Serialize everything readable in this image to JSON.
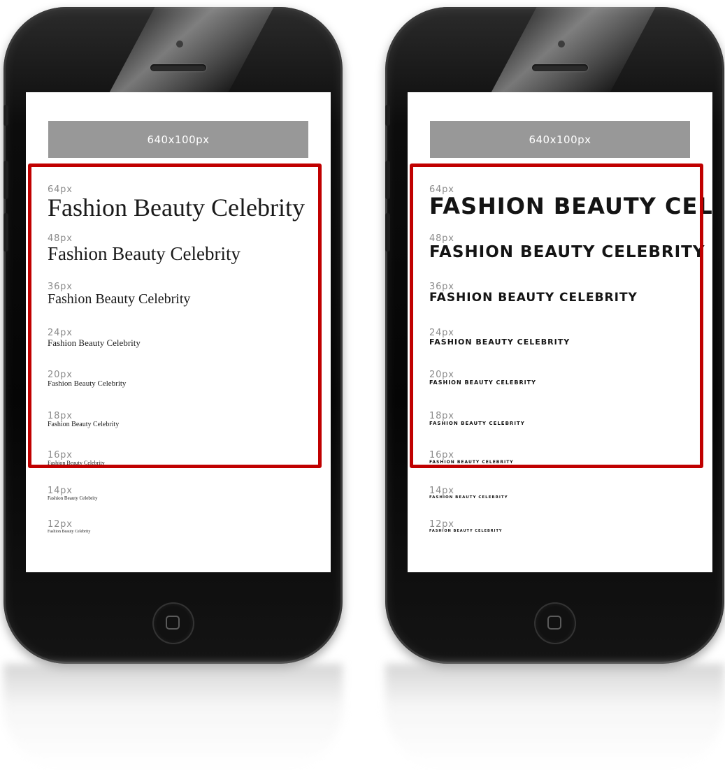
{
  "banner_label": "640x100px",
  "left_phone": {
    "rows": [
      {
        "size": "64px",
        "sample": "Fashion Beauty Celebrity"
      },
      {
        "size": "48px",
        "sample": "Fashion Beauty Celebrity"
      },
      {
        "size": "36px",
        "sample": "Fashion Beauty Celebrity"
      },
      {
        "size": "24px",
        "sample": "Fashion Beauty Celebrity"
      },
      {
        "size": "20px",
        "sample": "Fashion Beauty Celebrity"
      },
      {
        "size": "18px",
        "sample": "Fashion Beauty Celebrity"
      },
      {
        "size": "16px",
        "sample": "Fashion Beauty Celebrity"
      },
      {
        "size": "14px",
        "sample": "Fashion Beauty Celebrity"
      },
      {
        "size": "12px",
        "sample": "Fashion Beauty Celebrity"
      }
    ]
  },
  "right_phone": {
    "rows": [
      {
        "size": "64px",
        "sample": "FASHION BEAUTY CELEBRITY"
      },
      {
        "size": "48px",
        "sample": "FASHION BEAUTY CELEBRITY"
      },
      {
        "size": "36px",
        "sample": "FASHION BEAUTY CELEBRITY"
      },
      {
        "size": "24px",
        "sample": "FASHION BEAUTY CELEBRITY"
      },
      {
        "size": "20px",
        "sample": "FASHION BEAUTY CELEBRITY"
      },
      {
        "size": "18px",
        "sample": "FASHION BEAUTY CELEBRITY"
      },
      {
        "size": "16px",
        "sample": "FASHION BEAUTY CELEBRITY"
      },
      {
        "size": "14px",
        "sample": "FASHION BEAUTY CELEBRITY"
      },
      {
        "size": "12px",
        "sample": "FASHION BEAUTY CELEBRITY"
      }
    ]
  },
  "colors": {
    "highlight_border": "#c00000",
    "banner_background": "#989898",
    "size_label": "#8c8c8c"
  }
}
